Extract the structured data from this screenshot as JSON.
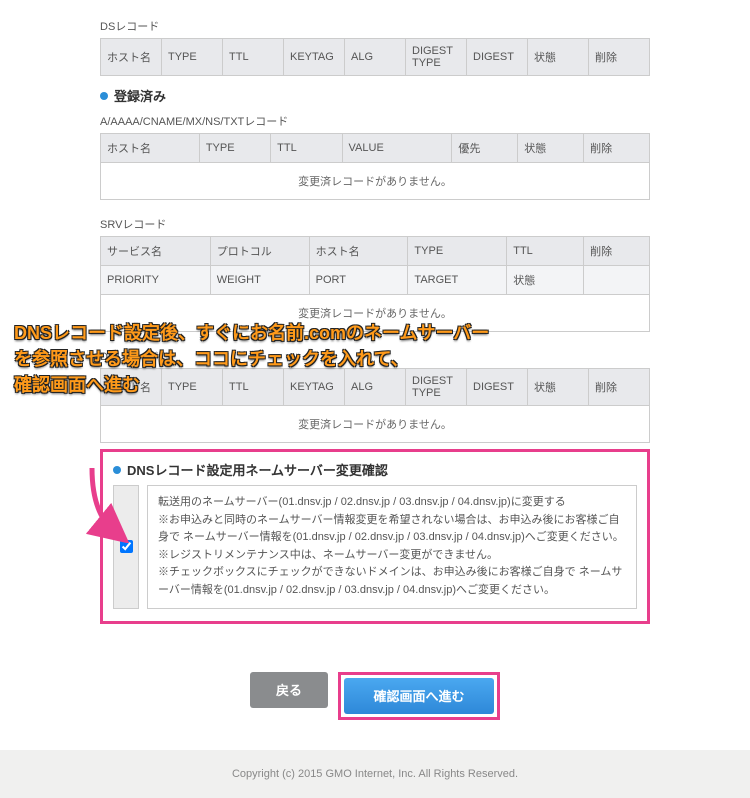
{
  "ds_table": {
    "label": "DSレコード",
    "headers": [
      "ホスト名",
      "TYPE",
      "TTL",
      "KEYTAG",
      "ALG",
      "DIGEST TYPE",
      "DIGEST",
      "状態",
      "削除"
    ]
  },
  "registered_title": "登録済み",
  "a_table": {
    "label": "A/AAAA/CNAME/MX/NS/TXTレコード",
    "headers": [
      "ホスト名",
      "TYPE",
      "TTL",
      "VALUE",
      "優先",
      "状態",
      "削除"
    ],
    "empty": "変更済レコードがありません。"
  },
  "srv_table": {
    "label": "SRVレコード",
    "headers1": [
      "サービス名",
      "プロトコル",
      "ホスト名",
      "TYPE",
      "TTL",
      "削除"
    ],
    "headers2": [
      "PRIORITY",
      "WEIGHT",
      "PORT",
      "TARGET",
      "状態",
      ""
    ],
    "empty": "変更済レコードがありません。"
  },
  "ds_table2": {
    "label": "DSレコード",
    "headers": [
      "ホスト名",
      "TYPE",
      "TTL",
      "KEYTAG",
      "ALG",
      "DIGEST TYPE",
      "DIGEST",
      "状態",
      "削除"
    ],
    "empty": "変更済レコードがありません。"
  },
  "ns_section": {
    "title": "DNSレコード設定用ネームサーバー変更確認",
    "line1": "転送用のネームサーバー(01.dnsv.jp / 02.dnsv.jp / 03.dnsv.jp / 04.dnsv.jp)に変更する",
    "note1": "※お申込みと同時のネームサーバー情報変更を希望されない場合は、お申込み後にお客様ご自身で ネームサーバー情報を(01.dnsv.jp / 02.dnsv.jp / 03.dnsv.jp / 04.dnsv.jp)へご変更ください。",
    "note2": "※レジストリメンテナンス中は、ネームサーバー変更ができません。",
    "note3": "※チェックボックスにチェックができないドメインは、お申込み後にお客様ご自身で ネームサーバー情報を(01.dnsv.jp / 02.dnsv.jp / 03.dnsv.jp / 04.dnsv.jp)へご変更ください。"
  },
  "buttons": {
    "back": "戻る",
    "confirm": "確認画面へ進む"
  },
  "footer": "Copyright (c) 2015 GMO Internet, Inc. All Rights Reserved.",
  "annotation": {
    "l1": "DNSレコード設定後、すぐにお名前.comのネームサーバー",
    "l2": "を参照させる場合は、ココにチェックを入れて、",
    "l3": "確認画面へ進む"
  },
  "colors": {
    "highlight": "#e83e8c",
    "accent": "#2a8ed8"
  }
}
